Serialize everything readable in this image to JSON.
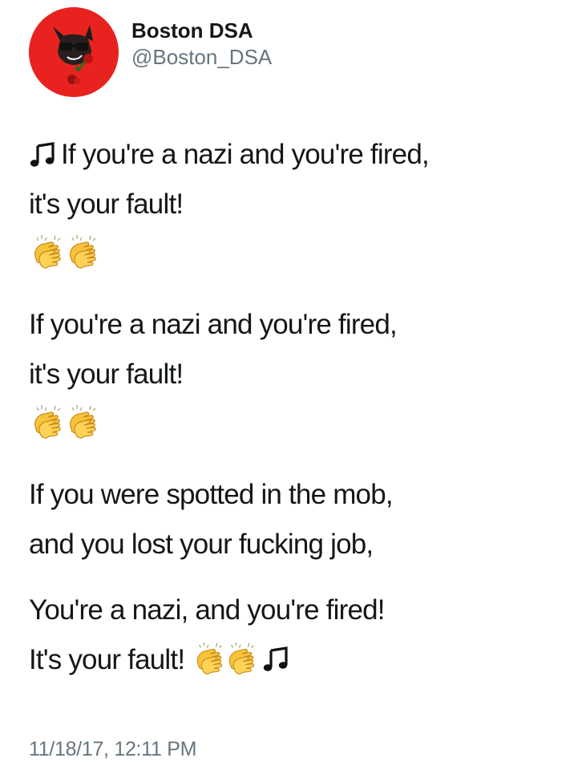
{
  "account": {
    "display_name": "Boston DSA",
    "handle": "@Boston_DSA",
    "avatar_color": "#e8231f",
    "avatar_icon": "dog-with-sunglasses-and-rose-avatar"
  },
  "tweet": {
    "lines": [
      "If you're a nazi and you're fired,",
      "it's your fault!",
      "If you're a nazi and you're fired,",
      "it's your fault!",
      "If you were spotted in the mob,",
      "and you lost your fucking job,",
      "You're a nazi, and you're fired!",
      "It's your fault!"
    ],
    "emoji": {
      "music_note": "music-note-icon",
      "clapping_hands": "clapping-hands-icon"
    }
  },
  "timestamp": "11/18/17, 12:11 PM",
  "colors": {
    "text": "#14171a",
    "secondary_text": "#66757f",
    "clap_yellow": "#f6c33a"
  }
}
